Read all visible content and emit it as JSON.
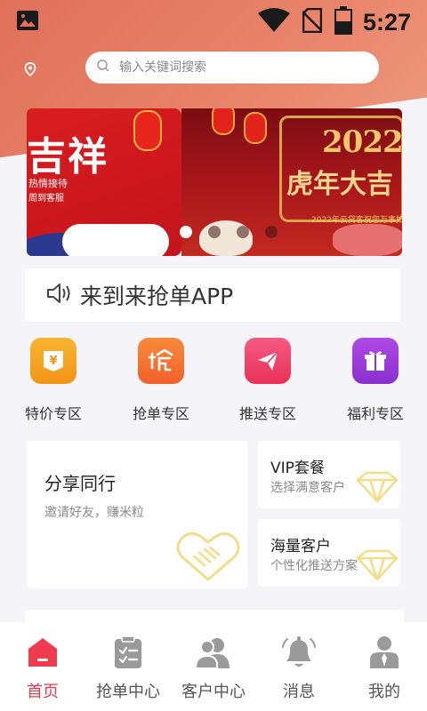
{
  "status_bar": {
    "time": "5:27",
    "icons": [
      "image-icon",
      "wifi-icon",
      "no-sim-icon",
      "battery-icon"
    ]
  },
  "search": {
    "placeholder": "输入关键词搜索"
  },
  "banner": {
    "slides": [
      {
        "title": "吉祥",
        "line1": "热情接待",
        "line2": "周到客服"
      },
      {
        "year": "2022",
        "headline": "虎年大吉",
        "subtitle": "2022年云贷客祝您万事如意"
      }
    ],
    "active_index": 0,
    "dot_count": 4
  },
  "notice": {
    "text": "来到来抢单APP"
  },
  "features": [
    {
      "label": "特价专区",
      "icon": "yuan-icon",
      "color": "#f5a020"
    },
    {
      "label": "抢单专区",
      "icon": "grab-icon",
      "color": "#f4702e"
    },
    {
      "label": "推送专区",
      "icon": "send-icon",
      "color": "#f0406a"
    },
    {
      "label": "福利专区",
      "icon": "gift-icon",
      "color": "#9a3bd8"
    }
  ],
  "cards": {
    "share": {
      "title": "分享同行",
      "subtitle": "邀请好友，赚米粒"
    },
    "vip": {
      "title": "VIP套餐",
      "subtitle": "选择满意客户"
    },
    "mass": {
      "title": "海量客户",
      "subtitle": "个性化推送方案"
    }
  },
  "tabbar": {
    "items": [
      {
        "label": "首页",
        "icon": "home-icon",
        "active": true
      },
      {
        "label": "抢单中心",
        "icon": "clipboard-icon",
        "active": false
      },
      {
        "label": "客户中心",
        "icon": "users-icon",
        "active": false
      },
      {
        "label": "消息",
        "icon": "bell-icon",
        "active": false
      },
      {
        "label": "我的",
        "icon": "person-icon",
        "active": false
      }
    ]
  },
  "colors": {
    "accent": "#e8384a",
    "hero": "#e0705a",
    "background": "#f5f5f9"
  }
}
